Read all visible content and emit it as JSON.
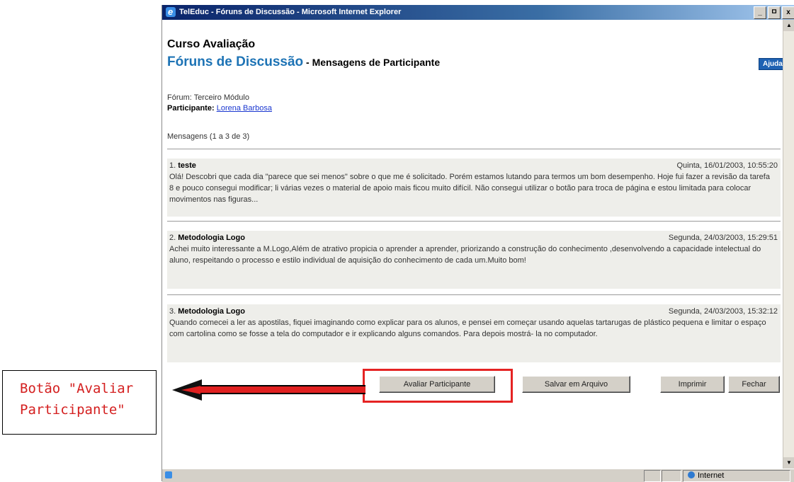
{
  "window": {
    "title": "TelEduc - Fóruns de Discussão - Microsoft Internet Explorer",
    "controls": [
      "_",
      "ㅁ",
      "x"
    ]
  },
  "page": {
    "course_title": "Curso Avaliação",
    "forum_title": "Fóruns de Discussão",
    "subtitle": " - Mensagens de Participante",
    "help_label": "Ajuda",
    "forum_label": "Fórum: Terceiro Módulo",
    "participant_label": "Participante:",
    "participant_name": "Lorena Barbosa",
    "messages_count": "Mensagens (1 a 3 de 3)"
  },
  "messages": [
    {
      "number": "1.",
      "title": "teste",
      "date": "Quinta, 16/01/2003, 10:55:20",
      "body": "Olá! Descobri que cada dia \"parece que sei menos\" sobre o que me é solicitado. Porém estamos lutando para termos um bom desempenho. Hoje fui fazer a revisão da tarefa 8 e pouco consegui modificar; li várias vezes o material de apoio mais ficou muito difícil. Não consegui utilizar o botão para troca de página e estou limitada para colocar movimentos nas figuras..."
    },
    {
      "number": "2.",
      "title": "Metodologia Logo",
      "date": "Segunda, 24/03/2003, 15:29:51",
      "body": "Achei muito interessante a M.Logo,Além de atrativo propicia o aprender a aprender, priorizando a construção do conhecimento ,desenvolvendo a capacidade intelectual do aluno, respeitando o processo e estilo individual de aquisição do conhecimento de cada um.Muito bom!"
    },
    {
      "number": "3.",
      "title": "Metodologia Logo",
      "date": "Segunda, 24/03/2003, 15:32:12",
      "body": "Quando comecei a ler as apostilas, fiquei imaginando como explicar para os alunos, e pensei em começar usando aquelas tartarugas de plástico pequena e limitar o espaço com cartolina como se fosse a tela do computador e ir explicando alguns comandos. Para depois mostrá- la no computador."
    }
  ],
  "buttons": {
    "evaluate": "Avaliar Participante",
    "save": "Salvar em Arquivo",
    "print": "Imprimir",
    "close": "Fechar"
  },
  "status": {
    "zone": "Internet"
  },
  "annotation": {
    "line1": "Botão \"Avaliar",
    "line2": "Participante\"",
    "color": "#d42020"
  }
}
